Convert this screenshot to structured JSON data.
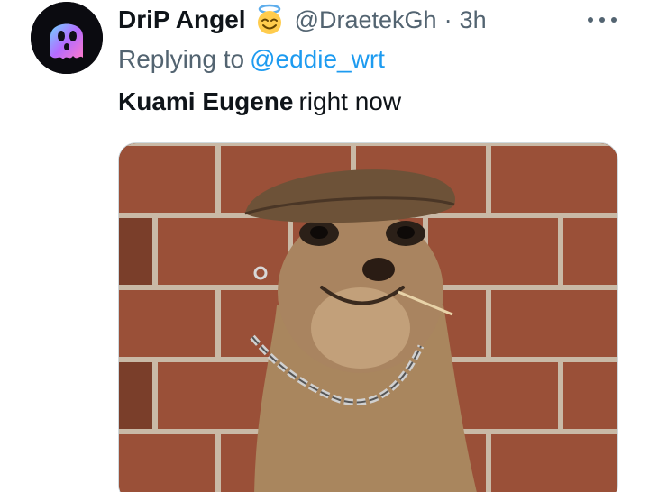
{
  "tweet": {
    "display_name": "DriP Angel",
    "name_emoji": "smiling-face-with-halo",
    "handle": "@DraetekGh",
    "separator": "·",
    "time": "3h",
    "reply_prefix": "Replying to",
    "reply_mention": "@eddie_wrt",
    "text_bold": "Kuami Eugene",
    "text_rest": "right now",
    "more_icon": "more-horizontal-icon",
    "avatar": "ghost-avatar",
    "media_description": "meerkat-in-flat-cap-with-chain-photo"
  },
  "colors": {
    "text_primary": "#0f1419",
    "text_secondary": "#536471",
    "link": "#1d9bf0",
    "border": "#cfd9de"
  }
}
